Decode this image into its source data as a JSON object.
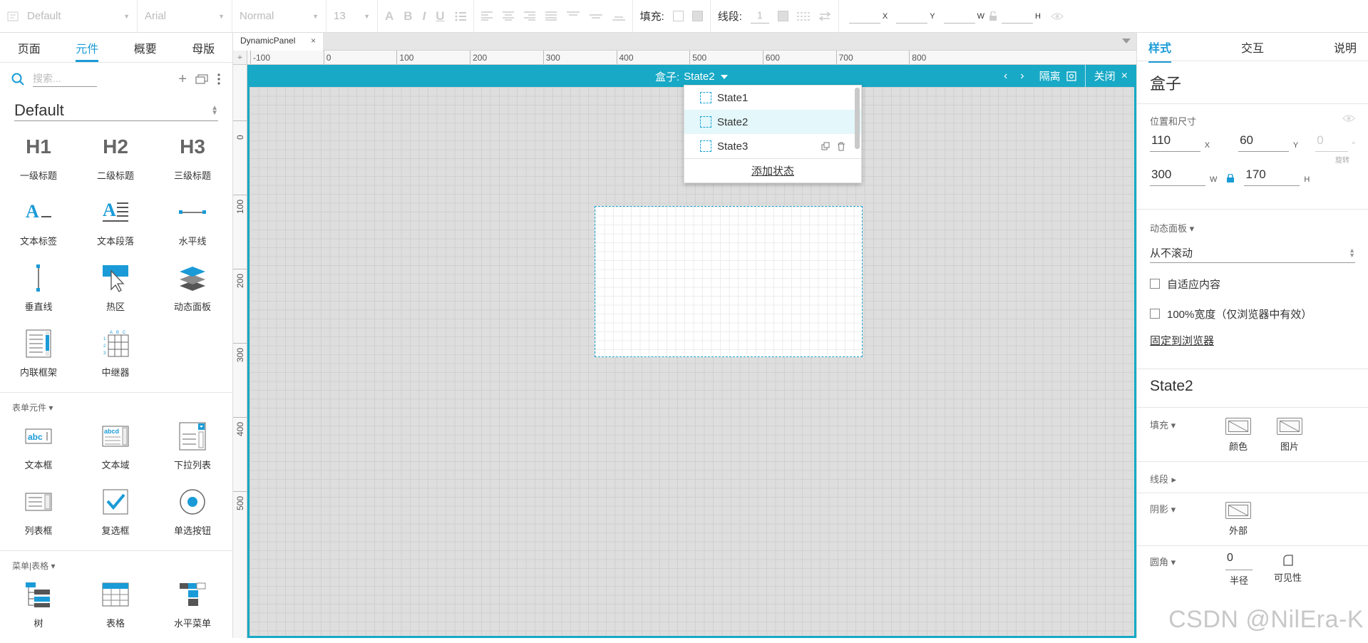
{
  "toolbar": {
    "style_value": "Default",
    "font_value": "Arial",
    "weight_value": "Normal",
    "size_value": "13",
    "fill_label": "填充:",
    "stroke_label": "线段:",
    "stroke_value": "1",
    "x_label": "X",
    "y_label": "Y",
    "w_label": "W",
    "h_label": "H"
  },
  "left_panel": {
    "tabs": [
      "页面",
      "元件",
      "概要",
      "母版"
    ],
    "active_tab": "元件",
    "search_placeholder": "搜索...",
    "library_name": "Default",
    "basic_widgets": [
      {
        "label": "一级标题",
        "icon": "H1"
      },
      {
        "label": "二级标题",
        "icon": "H2"
      },
      {
        "label": "三级标题",
        "icon": "H3"
      },
      {
        "label": "文本标签",
        "icon": "text-label-icon"
      },
      {
        "label": "文本段落",
        "icon": "text-paragraph-icon"
      },
      {
        "label": "水平线",
        "icon": "horizontal-line-icon"
      },
      {
        "label": "垂直线",
        "icon": "vertical-line-icon"
      },
      {
        "label": "热区",
        "icon": "hotspot-icon"
      },
      {
        "label": "动态面板",
        "icon": "dynamic-panel-icon"
      },
      {
        "label": "内联框架",
        "icon": "inline-frame-icon"
      },
      {
        "label": "中继器",
        "icon": "repeater-icon"
      }
    ],
    "form_section_title": "表单元件",
    "form_widgets": [
      {
        "label": "文本框",
        "icon": "text-field-icon",
        "icon_text": "abc"
      },
      {
        "label": "文本域",
        "icon": "text-area-icon",
        "icon_text": "abcd"
      },
      {
        "label": "下拉列表",
        "icon": "droplist-icon"
      },
      {
        "label": "列表框",
        "icon": "listbox-icon"
      },
      {
        "label": "复选框",
        "icon": "checkbox-icon"
      },
      {
        "label": "单选按钮",
        "icon": "radio-button-icon"
      }
    ],
    "menu_section_title": "菜单|表格",
    "menu_widgets": [
      {
        "label": "树",
        "icon": "tree-icon"
      },
      {
        "label": "表格",
        "icon": "table-icon"
      },
      {
        "label": "水平菜单",
        "icon": "horizontal-menu-icon"
      }
    ]
  },
  "doc_tab": {
    "title": "DynamicPanel"
  },
  "ruler": {
    "h_labels": [
      "-100",
      "0",
      "100",
      "200",
      "300",
      "400",
      "500",
      "600",
      "700",
      "800"
    ],
    "v_labels": [
      "0",
      "100",
      "200",
      "300",
      "400",
      "500"
    ]
  },
  "dynamic_panel_bar": {
    "title_prefix": "盒子:",
    "current_state": "State2",
    "isolate_label": "隔离",
    "close_label": "关闭"
  },
  "state_dropdown": {
    "states": [
      "State1",
      "State2",
      "State3"
    ],
    "selected": "State2",
    "add_state_label": "添加状态"
  },
  "right_panel": {
    "tabs": [
      "样式",
      "交互",
      "说明"
    ],
    "active_tab": "样式",
    "element_name": "盒子",
    "position_section_label": "位置和尺寸",
    "x_value": "110",
    "x_unit": "X",
    "y_value": "60",
    "y_unit": "Y",
    "rotation_value": "0",
    "rotation_unit": "°",
    "rotation_label": "旋转",
    "w_value": "300",
    "w_unit": "W",
    "h_value": "170",
    "h_unit": "H",
    "dynamic_panel_label": "动态面板",
    "scroll_value": "从不滚动",
    "fit_content_label": "自适应内容",
    "full_width_label": "100%宽度（仅浏览器中有效）",
    "pin_browser_label": "固定到浏览器",
    "state_name": "State2",
    "fill_label": "填充",
    "fill_color_label": "颜色",
    "fill_image_label": "图片",
    "stroke_label": "线段",
    "shadow_label": "阴影",
    "shadow_outer_label": "外部",
    "radius_label": "圆角",
    "radius_value": "0",
    "radius_unit_label": "半径",
    "visibility_label": "可见性"
  },
  "watermark": "CSDN @NilEra-K",
  "colors": {
    "accent": "#17a9c6",
    "tab_active": "#1a9bd7",
    "canvas_bg": "#dedede"
  }
}
